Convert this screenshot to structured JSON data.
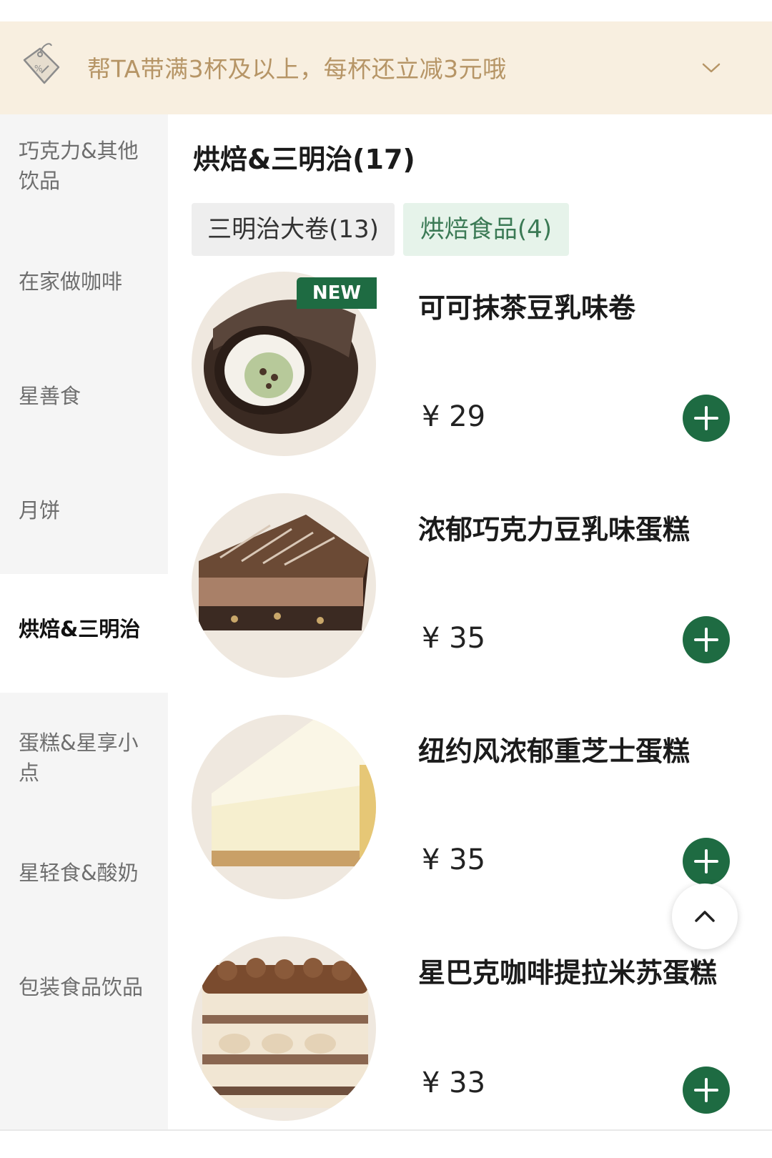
{
  "promo": {
    "text": "帮TA带满3杯及以上，每杯还立减3元哦",
    "icon": "price-tag-icon",
    "expand_icon": "chevron-down-icon"
  },
  "sidebar": {
    "items": [
      {
        "label": "巧克力&其他饮品",
        "active": false
      },
      {
        "label": "在家做咖啡",
        "active": false
      },
      {
        "label": "星善食",
        "active": false
      },
      {
        "label": "月饼",
        "active": false
      },
      {
        "label": "烘焙&三明治",
        "active": true
      },
      {
        "label": "蛋糕&星享小点",
        "active": false
      },
      {
        "label": "星轻食&酸奶",
        "active": false
      },
      {
        "label": "包装食品饮品",
        "active": false
      }
    ]
  },
  "main": {
    "title": "烘焙&三明治(17)",
    "chips": [
      {
        "label": "三明治大卷(13)",
        "selected": false
      },
      {
        "label": "烘焙食品(4)",
        "selected": true
      }
    ],
    "badge": "NEW",
    "products": [
      {
        "name": "可可抹茶豆乳味卷",
        "price": "¥ 29",
        "image": "cocoa-matcha-roll"
      },
      {
        "name": "浓郁巧克力豆乳味蛋糕",
        "price": "¥ 35",
        "image": "chocolate-cake-slice"
      },
      {
        "name": "纽约风浓郁重芝士蛋糕",
        "price": "¥ 35",
        "image": "cheesecake-slice"
      },
      {
        "name": "星巴克咖啡提拉米苏蛋糕",
        "price": "¥ 33",
        "image": "tiramisu-slice"
      }
    ]
  },
  "colors": {
    "brand_green": "#1e6b42",
    "promo_bg": "#f8efe0",
    "promo_text": "#b69566",
    "sidebar_bg": "#f5f5f5"
  },
  "scroll_top_icon": "chevron-up-icon"
}
